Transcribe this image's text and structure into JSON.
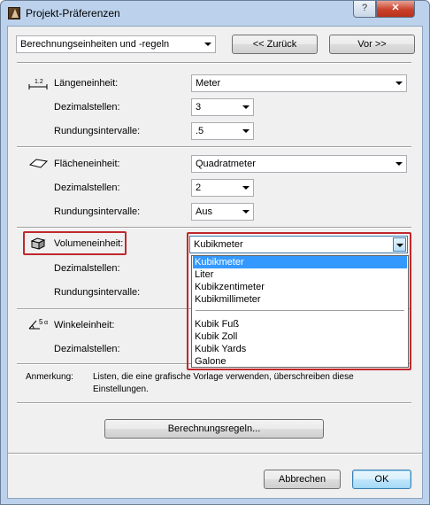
{
  "window": {
    "title": "Projekt-Präferenzen",
    "help_label": "?",
    "close_label": "✕"
  },
  "nav": {
    "page_select": "Berechnungseinheiten und -regeln",
    "back_label": "<< Zurück",
    "forward_label": "Vor >>"
  },
  "length": {
    "unit_label": "Längeneinheit:",
    "unit_value": "Meter",
    "decimals_label": "Dezimalstellen:",
    "decimals_value": "3",
    "rounding_label": "Rundungsintervalle:",
    "rounding_value": ".5",
    "icon_text": "1.2"
  },
  "area": {
    "unit_label": "Flächeneinheit:",
    "unit_value": "Quadratmeter",
    "decimals_label": "Dezimalstellen:",
    "decimals_value": "2",
    "rounding_label": "Rundungsintervalle:",
    "rounding_value": "Aus"
  },
  "volume": {
    "unit_label": "Volumeneinheit:",
    "unit_value": "Kubikmeter",
    "decimals_label": "Dezimalstellen:",
    "rounding_label": "Rundungsintervalle:",
    "options": [
      "Kubikmeter",
      "Liter",
      "Kubikzentimeter",
      "Kubikmillimeter",
      "Kubik Fuß",
      "Kubik Zoll",
      "Kubik Yards",
      "Galone"
    ],
    "highlight_color": "#c0282d",
    "selection_color": "#3399ff"
  },
  "angle": {
    "unit_label": "Winkeleinheit:",
    "decimals_label": "Dezimalstellen:",
    "icon_text": "5"
  },
  "note": {
    "label": "Anmerkung:",
    "text_line1": "Listen, die eine grafische Vorlage verwenden, überschreiben diese",
    "text_line2": "Einstellungen."
  },
  "calc_rules_label": "Berechnungsregeln...",
  "footer": {
    "cancel_label": "Abbrechen",
    "ok_label": "OK"
  }
}
